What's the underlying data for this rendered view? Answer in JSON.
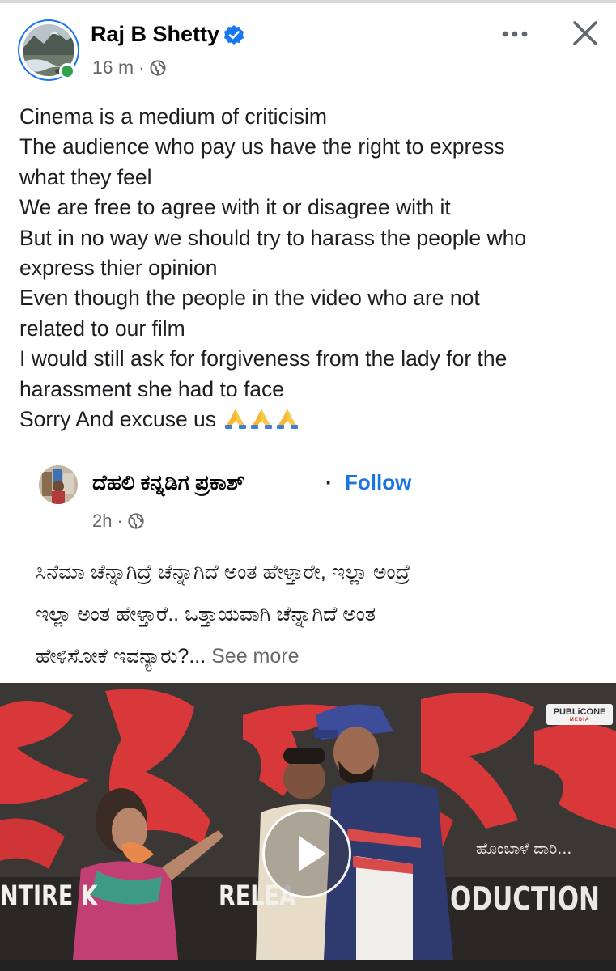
{
  "post": {
    "author": "Raj B Shetty",
    "time": "16 m",
    "separator": "·",
    "lines": [
      "Cinema is a medium of criticisim",
      "The audience who pay us have the right to express",
      "what they feel",
      "We are free to agree with it or disagree with it",
      "But in no way we should try to harass the people who",
      "express thier opinion",
      "Even though the people in the video who are not",
      "related to our film",
      "I would still ask for forgiveness from the lady for the",
      "harassment she had to face"
    ],
    "last_line": "Sorry And excuse us",
    "emoji": [
      "folded-hands",
      "folded-hands",
      "folded-hands"
    ]
  },
  "shared": {
    "author": "ದೆಹಲಿ ಕನ್ನಡಿಗ ಪ್ರಕಾಶ್",
    "dot": "·",
    "follow": "Follow",
    "time": "2h",
    "separator": "·",
    "lines": [
      "ಸಿನೆಮಾ ಚೆನ್ನಾಗಿದ್ರೆ ಚೆನ್ನಾಗಿದೆ ಅಂತ ಹೇಳ್ತಾರೇ, ಇಲ್ಲಾ ಅಂದ್ರೆ",
      "ಇಲ್ಲಾ ಅಂತ ಹೇಳ್ತಾರೆ.. ಒತ್ತಾಯವಾಗಿ ಚೆನ್ನಾಗಿದೆ ಅಂತ",
      "ಹೇಳಿಸೋಕೆ ಇವನ್ಯಾರು?..."
    ],
    "see_more": "See more"
  },
  "video": {
    "watermark": "PUBLiCONE",
    "watermark_sub": "MEDIA",
    "banner_left": "NTIRE K",
    "banner_mid": "RELEA",
    "banner_right": "ODUCTION",
    "banner_kannada": "ಹೊಂಬಾಳೆ ದಾರಿ..."
  },
  "colors": {
    "accent": "#1877f2",
    "follow": "#1b74e4",
    "meta": "#65676b",
    "online": "#31a24c",
    "banner_red": "#d9383a"
  }
}
